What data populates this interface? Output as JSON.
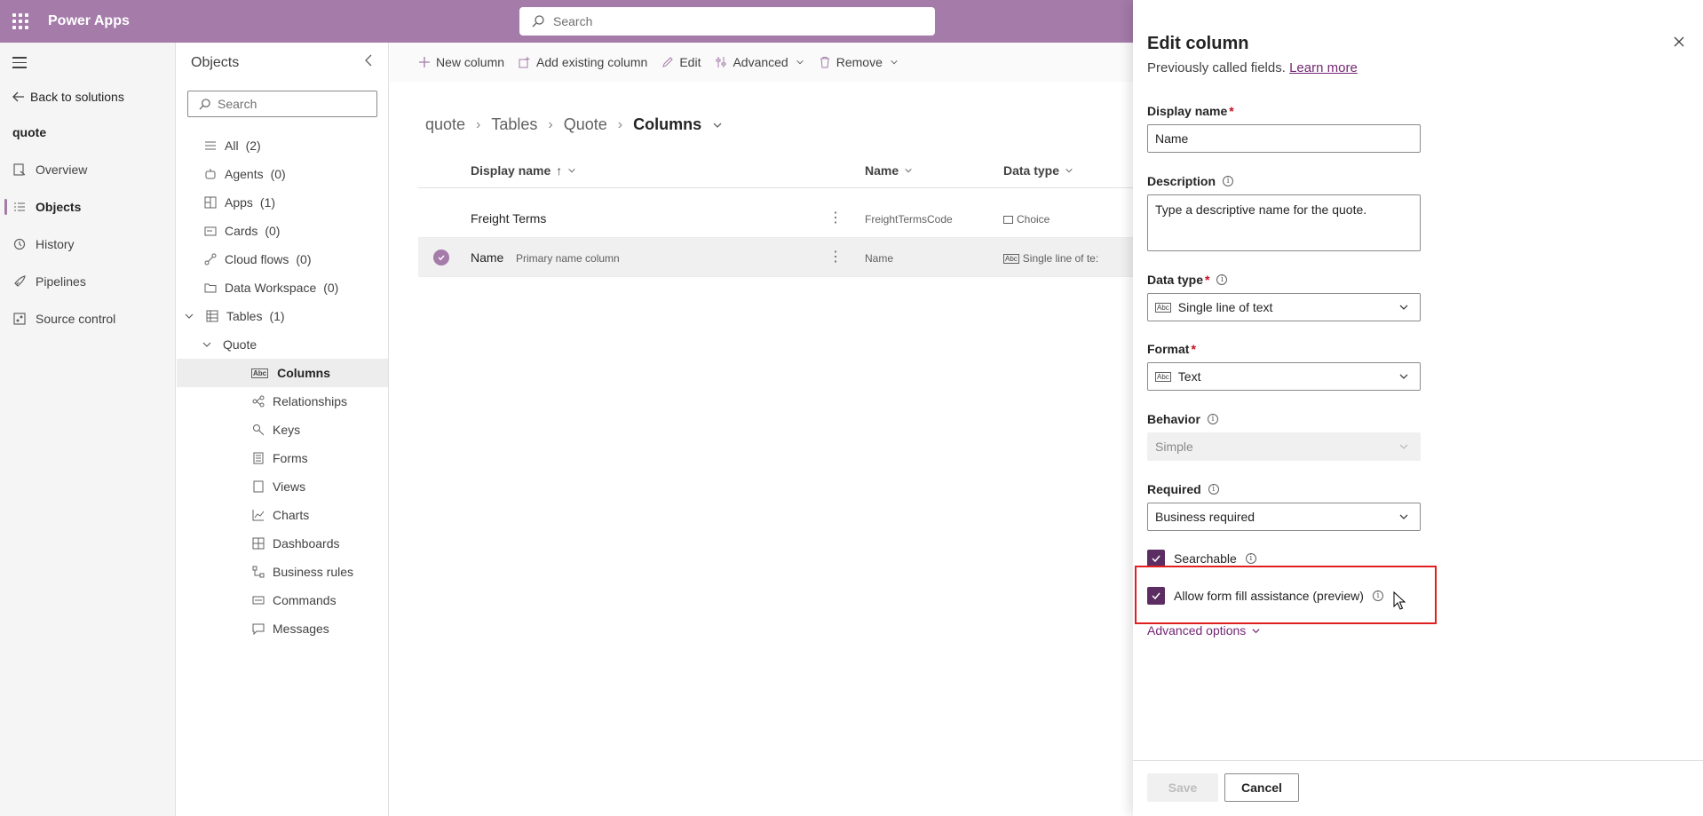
{
  "topbar": {
    "app_title": "Power Apps",
    "search_placeholder": "Search"
  },
  "leftnav": {
    "back_label": "Back to solutions",
    "solution_name": "quote",
    "items": [
      {
        "label": "Overview",
        "icon": "overview-icon"
      },
      {
        "label": "Objects",
        "icon": "objects-icon",
        "active": true
      },
      {
        "label": "History",
        "icon": "history-icon"
      },
      {
        "label": "Pipelines",
        "icon": "rocket-icon"
      },
      {
        "label": "Source control",
        "icon": "source-control-icon"
      }
    ]
  },
  "objects": {
    "title": "Objects",
    "search_placeholder": "Search",
    "tree": [
      {
        "label": "All",
        "count": "(2)"
      },
      {
        "label": "Agents",
        "count": "(0)"
      },
      {
        "label": "Apps",
        "count": "(1)"
      },
      {
        "label": "Cards",
        "count": "(0)"
      },
      {
        "label": "Cloud flows",
        "count": "(0)"
      },
      {
        "label": "Data Workspace",
        "count": "(0)"
      },
      {
        "label": "Tables",
        "count": "(1)"
      },
      {
        "label": "Quote"
      },
      {
        "label": "Columns",
        "selected": true
      },
      {
        "label": "Relationships"
      },
      {
        "label": "Keys"
      },
      {
        "label": "Forms"
      },
      {
        "label": "Views"
      },
      {
        "label": "Charts"
      },
      {
        "label": "Dashboards"
      },
      {
        "label": "Business rules"
      },
      {
        "label": "Commands"
      },
      {
        "label": "Messages"
      }
    ]
  },
  "commandbar": {
    "new_column": "New column",
    "add_existing": "Add existing column",
    "edit": "Edit",
    "advanced": "Advanced",
    "remove": "Remove"
  },
  "breadcrumb": {
    "b1": "quote",
    "b2": "Tables",
    "b3": "Quote",
    "b4": "Columns"
  },
  "grid": {
    "headers": {
      "display_name": "Display name",
      "name": "Name",
      "data_type": "Data type"
    },
    "rows": [
      {
        "display_name": "Freight Terms",
        "tag": "",
        "name": "FreightTermsCode",
        "data_type": "Choice"
      },
      {
        "display_name": "Name",
        "tag": "Primary name column",
        "name": "Name",
        "data_type": "Single line of te:"
      }
    ]
  },
  "panel": {
    "title": "Edit column",
    "subtitle": "Previously called fields.",
    "learn_more": "Learn more",
    "display_name_label": "Display name",
    "display_name_value": "Name",
    "description_label": "Description",
    "description_value": "Type a descriptive name for the quote.",
    "data_type_label": "Data type",
    "data_type_value": "Single line of text",
    "format_label": "Format",
    "format_value": "Text",
    "behavior_label": "Behavior",
    "behavior_value": "Simple",
    "required_label": "Required",
    "required_value": "Business required",
    "searchable_label": "Searchable",
    "form_fill_label": "Allow form fill assistance (preview)",
    "advanced_options": "Advanced options",
    "save": "Save",
    "cancel": "Cancel",
    "required_mark": "*"
  },
  "colors": {
    "accent": "#a47ba9",
    "checkbox": "#5c2d62",
    "link": "#742774",
    "highlight": "#e02020"
  }
}
